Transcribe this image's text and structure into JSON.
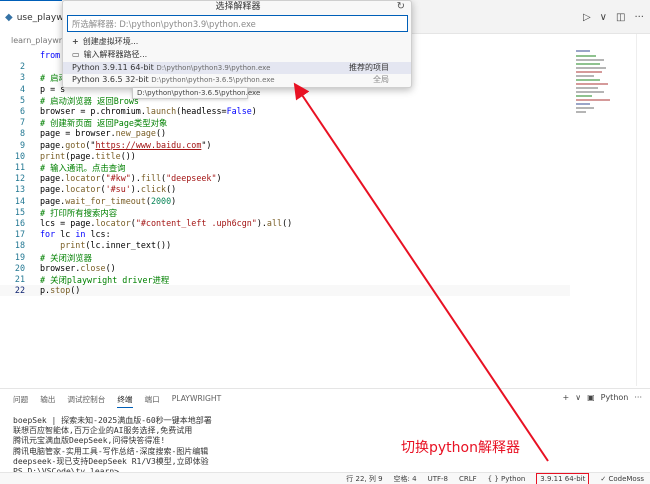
{
  "tabbar": {
    "tab_label": "use_playwrig",
    "actions": [
      "▷",
      "∨",
      "◫",
      "···"
    ]
  },
  "breadcrumb": "learn_playwrigh",
  "editor": {
    "lines": [
      {
        "n": "",
        "parts": [
          [
            "kw",
            "from"
          ]
        ]
      },
      {
        "n": "2",
        "parts": []
      },
      {
        "n": "3",
        "parts": [
          [
            "cm",
            "# 启动"
          ]
        ]
      },
      {
        "n": "4",
        "parts": [
          [
            "",
            "p = s"
          ]
        ]
      },
      {
        "n": "5",
        "parts": [
          [
            "cm",
            "# 启动浏览器 返回Brows"
          ]
        ]
      },
      {
        "n": "6",
        "parts": [
          [
            "",
            "browser = p.chromium."
          ],
          [
            "fn",
            "launch"
          ],
          [
            "",
            "(headless="
          ],
          [
            "kw",
            "False"
          ],
          [
            "",
            ")"
          ]
        ]
      },
      {
        "n": "7",
        "parts": [
          [
            "cm",
            "# 创建新页面 返回Page类型对象"
          ]
        ]
      },
      {
        "n": "8",
        "parts": [
          [
            "",
            "page = browser."
          ],
          [
            "fn",
            "new_page"
          ],
          [
            "",
            "()"
          ]
        ]
      },
      {
        "n": "9",
        "parts": [
          [
            "",
            "page."
          ],
          [
            "fn",
            "goto"
          ],
          [
            "",
            "(\""
          ],
          [
            "url",
            "https://www.baidu.com"
          ],
          [
            "",
            "\")"
          ]
        ]
      },
      {
        "n": "10",
        "parts": [
          [
            "fn",
            "print"
          ],
          [
            "",
            "(page."
          ],
          [
            "fn",
            "title"
          ],
          [
            "",
            "())"
          ]
        ]
      },
      {
        "n": "11",
        "parts": [
          [
            "cm",
            "# 输入通讯。点击查询"
          ]
        ]
      },
      {
        "n": "12",
        "parts": [
          [
            "",
            "page."
          ],
          [
            "fn",
            "locator"
          ],
          [
            "",
            "("
          ],
          [
            "st",
            "\"#kw\""
          ],
          [
            "",
            ")."
          ],
          [
            "fn",
            "fill"
          ],
          [
            "",
            "("
          ],
          [
            "st",
            "\"deepseek\""
          ],
          [
            "",
            ")"
          ]
        ]
      },
      {
        "n": "13",
        "parts": [
          [
            "",
            "page."
          ],
          [
            "fn",
            "locator"
          ],
          [
            "",
            "("
          ],
          [
            "st",
            "'#su'"
          ],
          [
            "",
            ")."
          ],
          [
            "fn",
            "click"
          ],
          [
            "",
            "()"
          ]
        ]
      },
      {
        "n": "14",
        "parts": [
          [
            "",
            "page."
          ],
          [
            "fn",
            "wait_for_timeout"
          ],
          [
            "",
            "("
          ],
          [
            "nm",
            "2000"
          ],
          [
            "",
            ")"
          ]
        ]
      },
      {
        "n": "15",
        "parts": [
          [
            "cm",
            "# 打印所有搜索内容"
          ]
        ]
      },
      {
        "n": "16",
        "parts": [
          [
            "",
            "lcs = page."
          ],
          [
            "fn",
            "locator"
          ],
          [
            "",
            "("
          ],
          [
            "st",
            "\"#content_left .uph6cgn\""
          ],
          [
            "",
            ")."
          ],
          [
            "fn",
            "all"
          ],
          [
            "",
            "()"
          ]
        ]
      },
      {
        "n": "17",
        "parts": [
          [
            "kw",
            "for"
          ],
          [
            "",
            " lc "
          ],
          [
            "kw",
            "in"
          ],
          [
            "",
            " lcs:"
          ]
        ]
      },
      {
        "n": "18",
        "parts": [
          [
            "",
            "    "
          ],
          [
            "fn",
            "print"
          ],
          [
            "",
            "(lc.inner_text())"
          ]
        ]
      },
      {
        "n": "19",
        "parts": [
          [
            "cm",
            "# 关闭浏览器"
          ]
        ]
      },
      {
        "n": "20",
        "parts": [
          [
            "",
            "browser."
          ],
          [
            "fn",
            "close"
          ],
          [
            "",
            "()"
          ]
        ]
      },
      {
        "n": "21",
        "parts": [
          [
            "cm",
            "# 关闭playwright driver进程"
          ]
        ]
      },
      {
        "n": "22",
        "parts": [
          [
            "",
            "p."
          ],
          [
            "fn",
            "stop"
          ],
          [
            "",
            "()"
          ]
        ]
      }
    ],
    "current_line": "22"
  },
  "picker": {
    "title": "选择解释器",
    "refresh_icon": "↻",
    "input_placeholder": "所选解释器: D:\\python\\python3.9\\python.exe",
    "items": {
      "create": "创建虚拟环境...",
      "browse": "输入解释器路径...",
      "py39_name": "Python 3.9.11 64-bit",
      "py39_path": "D:\\python\\python3.9\\python.exe",
      "py39_tag": "推荐的项目",
      "py36_name": "Python 3.6.5 32-bit",
      "py36_path": "D:\\python\\python-3.6.5\\python.exe",
      "py36_tag": "全局"
    },
    "tooltip": "D:\\python\\python-3.6.5\\python.exe"
  },
  "panel": {
    "tabs": [
      "问题",
      "输出",
      "调试控制台",
      "终端",
      "端口",
      "PLAYWRIGHT"
    ],
    "active_tab": "终端",
    "actions": {
      "add": "+",
      "shell": "Python",
      "more": "···"
    },
    "terminal": [
      "boepSek | 探索未知-2025满血版-60秒一键本地部署",
      "联想百应智能体,百万企业的AI服务选择,免费试用",
      "腾讯元宝满血版DeepSeek,问得快答得准!",
      "腾讯电脑管家-实用工具-写作总结-深度搜索-图片编辑",
      "deepseek-现已支持DeepSeek R1/V3模型,立即体验",
      "PS D:\\VSCode\\tv_learn>"
    ]
  },
  "annotation": "切换python解释器",
  "statusbar": {
    "position": "行 22, 列 9",
    "spaces": "空格: 4",
    "encoding": "UTF-8",
    "eol": "CRLF",
    "language": "{ } Python",
    "interpreter": "3.9.11 64-bit",
    "codemoss": "✓ CodeMoss"
  },
  "colors": {
    "accent": "#005fb8",
    "annotation": "#e81123"
  }
}
